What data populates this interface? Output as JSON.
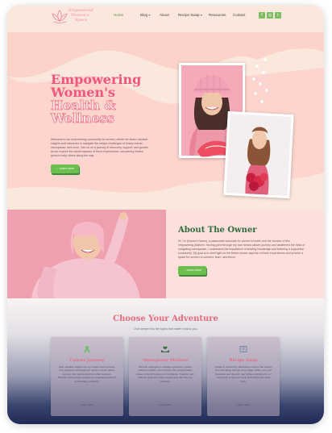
{
  "brand": {
    "name_line1": "Empowered",
    "name_line2": "Women's",
    "name_line3": "Space"
  },
  "nav": {
    "items": [
      {
        "label": "Home",
        "active": true
      },
      {
        "label": "Blog",
        "caret": "▾"
      },
      {
        "label": "About"
      },
      {
        "label": "Recipe Swap",
        "caret": "▾"
      },
      {
        "label": "Resources"
      },
      {
        "label": "Contact"
      }
    ],
    "social": [
      "f",
      "◎",
      "t"
    ]
  },
  "hero": {
    "title_line1": "Empowering",
    "title_line2": "Women's",
    "title_line3": "Health &",
    "title_line4": "Wellness",
    "text": "Welcome to our empowering community for women, where we share valuable insights and resources to navigate the unique challenges of heavy cancer, menopause, and more. Join us on a journey of discovery, support, and growth as we explore the untold aspects of these experiences, uncovering hidden gems to help others along the way.",
    "button": "→ Learn more"
  },
  "about": {
    "title": "About The Owner",
    "text": "Hi, I'm [Owner's Name], a passionate advocate for women's health and the founder of this empowering platform. Having gone through my own breast cancer journey and weathered the trials of navigating menopause, I understand the importance of sharing knowledge and fostering a supportive community. My goal is to shed light on the lesser-known aspects of these experiences and provide a space for women to connect, learn, and thrive.",
    "button": "→ Learn more"
  },
  "adventure": {
    "title": "Choose Your Adventure",
    "subtitle": "Dive deeper into the topics that matter most to you",
    "cards": [
      {
        "title": "Cancer Journey",
        "icon": "ribbon-icon",
        "text": "Gain valuable insights into my breast cancer journey, from diagnosis and treatment options to side effects, recovery tips, and stories from other survivors. Discover lesser-known aspects of navigating treatment and building resilience.",
        "link": "Learn more"
      },
      {
        "title": "Menopause Matters",
        "icon": "hands-heart-icon",
        "text": "Discover strategies to manage symptoms, explore natural remedies, and embrace this transformative phase of life with grace and confidence. Together we'll debunk myths and share experiences that often go unspoken.",
        "link": "Learn more"
      },
      {
        "title": "Recipe Swap",
        "icon": "recipe-book-icon",
        "text": "Indulge in nourishing, wholesome recipes that support your well-being through every stage. Share your own favourites and discover new dishes submitted by our community to fuel your body and delight your taste buds.",
        "link": "Learn more"
      }
    ]
  },
  "colors": {
    "accent_pink": "#f0587a",
    "accent_green": "#6cbf4d",
    "heading_green": "#2f6b3c",
    "hero_bg": "#fbe8dc"
  }
}
